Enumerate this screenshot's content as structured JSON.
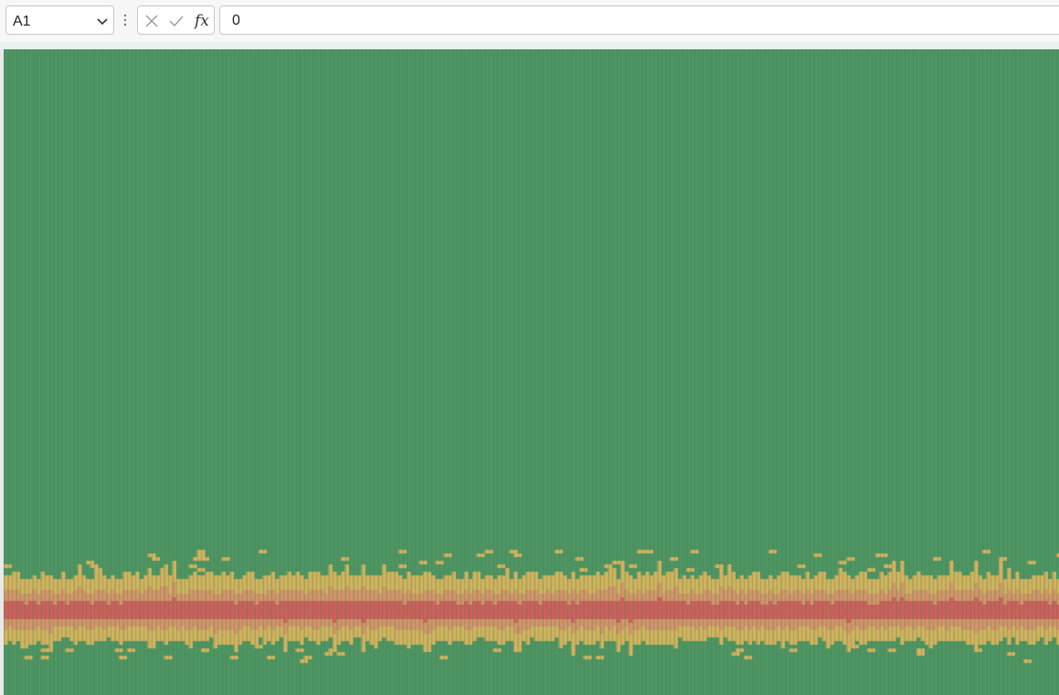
{
  "formula_bar": {
    "name_box_value": "A1",
    "cancel_icon": "x-icon",
    "enter_icon": "check-icon",
    "fx_label": "fx",
    "formula_value": "0"
  },
  "sheet": {
    "description_colors": {
      "background": "#4f9463",
      "band_outer": "#d4b35e",
      "band_mid": "#d6946a",
      "band_core": "#d05f5c",
      "gridline": "#3e8051"
    }
  }
}
